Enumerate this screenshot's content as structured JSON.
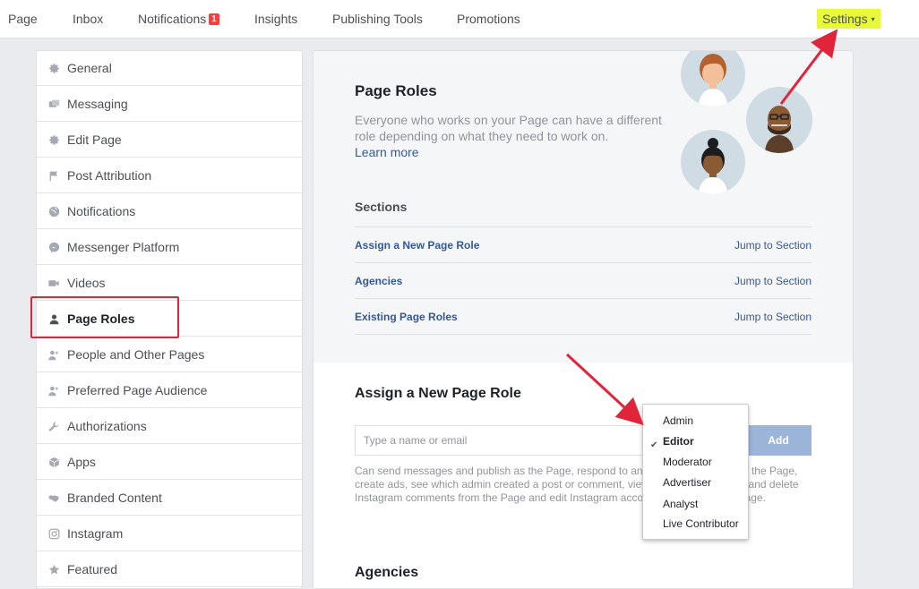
{
  "topnav": {
    "items": [
      {
        "label": "Page"
      },
      {
        "label": "Inbox"
      },
      {
        "label": "Notifications",
        "badge": "1"
      },
      {
        "label": "Insights"
      },
      {
        "label": "Publishing Tools"
      },
      {
        "label": "Promotions"
      }
    ],
    "settings_label": "Settings",
    "settings_caret": "▾"
  },
  "sidebar": {
    "items": [
      {
        "label": "General",
        "icon": "gear-icon"
      },
      {
        "label": "Messaging",
        "icon": "messaging-icon"
      },
      {
        "label": "Edit Page",
        "icon": "gear-icon"
      },
      {
        "label": "Post Attribution",
        "icon": "flag-icon"
      },
      {
        "label": "Notifications",
        "icon": "globe-icon"
      },
      {
        "label": "Messenger Platform",
        "icon": "messenger-icon"
      },
      {
        "label": "Videos",
        "icon": "video-camera-icon"
      },
      {
        "label": "Page Roles",
        "icon": "person-icon",
        "active": true
      },
      {
        "label": "People and Other Pages",
        "icon": "people-icon"
      },
      {
        "label": "Preferred Page Audience",
        "icon": "people-icon"
      },
      {
        "label": "Authorizations",
        "icon": "wrench-icon"
      },
      {
        "label": "Apps",
        "icon": "cube-icon"
      },
      {
        "label": "Branded Content",
        "icon": "handshake-icon"
      },
      {
        "label": "Instagram",
        "icon": "instagram-icon"
      },
      {
        "label": "Featured",
        "icon": "star-icon"
      }
    ]
  },
  "main": {
    "title": "Page Roles",
    "description": "Everyone who works on your Page can have a different role depending on what they need to work on.",
    "learn_more": "Learn more",
    "sections_title": "Sections",
    "sections": [
      {
        "name": "Assign a New Page Role",
        "jump": "Jump to Section"
      },
      {
        "name": "Agencies",
        "jump": "Jump to Section"
      },
      {
        "name": "Existing Page Roles",
        "jump": "Jump to Section"
      }
    ],
    "assign_title": "Assign a New Page Role",
    "input_placeholder": "Type a name or email",
    "add_label": "Add",
    "help_text": "Can send messages and publish as the Page, respond to and delete comments on the Page, create ads, see which admin created a post or comment, view insights, respond to and delete Instagram comments from the Page and edit Instagram account details from the Page.",
    "agencies_title": "Agencies"
  },
  "role_dropdown": {
    "options": [
      "Admin",
      "Editor",
      "Moderator",
      "Advertiser",
      "Analyst",
      "Live Contributor"
    ],
    "selected": "Editor"
  },
  "colors": {
    "link": "#365899",
    "highlight": "#e8f93a",
    "annotation_red": "#e0253a",
    "add_button": "#9cb4d8"
  }
}
